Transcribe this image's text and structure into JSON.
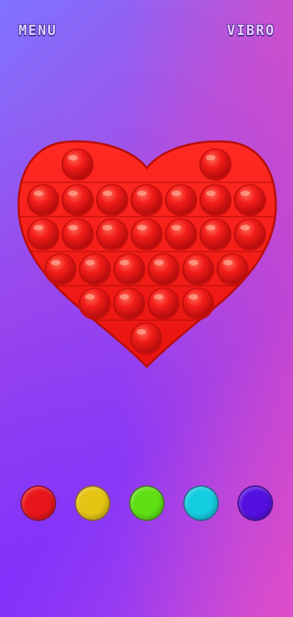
{
  "header": {
    "menu_label": "MENU",
    "vibro_label": "VIBRO"
  },
  "popit": {
    "shape": "heart",
    "color": "#ef1c1c",
    "rows": [
      2,
      7,
      7,
      6,
      4,
      1
    ]
  },
  "color_options": [
    {
      "name": "red",
      "hex": "#e8161a"
    },
    {
      "name": "yellow",
      "hex": "#e5c414"
    },
    {
      "name": "green",
      "hex": "#5fe014"
    },
    {
      "name": "cyan",
      "hex": "#14cde0"
    },
    {
      "name": "violet",
      "hex": "#5410e0"
    }
  ]
}
